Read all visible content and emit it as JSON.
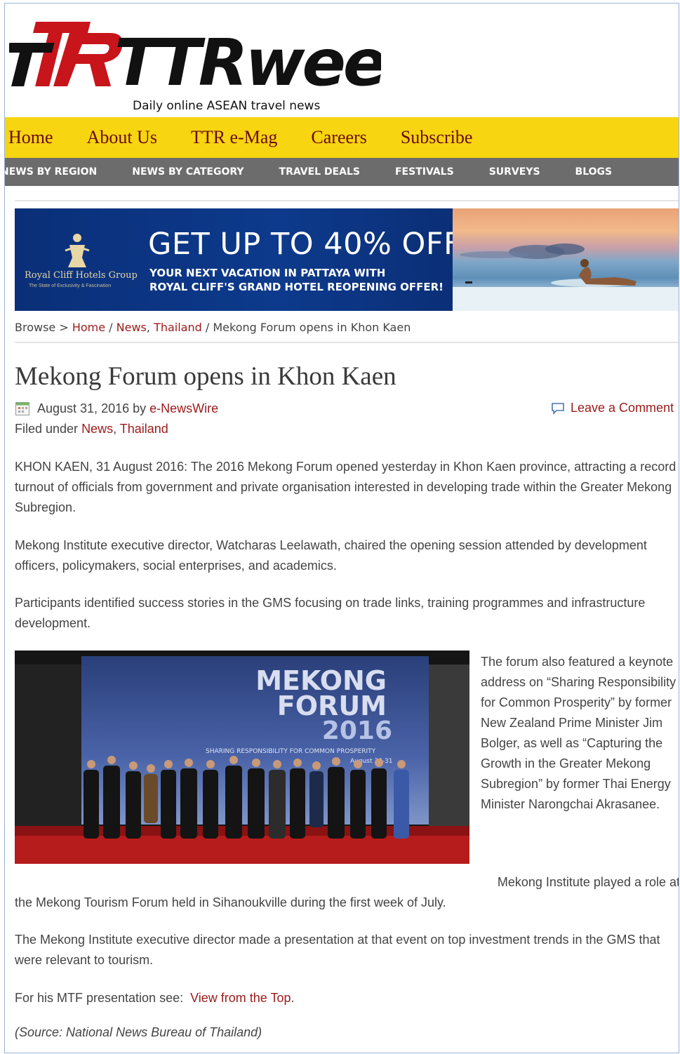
{
  "site": {
    "logo_text": "TTRweekly",
    "tagline": "Daily online ASEAN travel news"
  },
  "topnav": [
    "Home",
    "About Us",
    "TTR e-Mag",
    "Careers",
    "Subscribe"
  ],
  "subnav": [
    "NEWS BY REGION",
    "NEWS BY CATEGORY",
    "TRAVEL DEALS",
    "FESTIVALS",
    "SURVEYS",
    "BLOGS"
  ],
  "banner": {
    "brand": "Royal Cliff Hotels Group",
    "brand_tagline": "The State of Exclusivity & Fascination",
    "headline": "GET UP TO 40% OFF",
    "sub_line1": "YOUR NEXT VACATION IN PATTAYA WITH",
    "sub_line2": "ROYAL CLIFF'S GRAND HOTEL REOPENING OFFER!"
  },
  "breadcrumb": {
    "browse": "Browse >",
    "home": "Home",
    "sep1": " / ",
    "news": "News",
    "comma": ", ",
    "thailand": "Thailand",
    "sep2": " / ",
    "current": "Mekong Forum opens in Khon Kaen"
  },
  "article": {
    "title": "Mekong Forum opens in Khon Kaen",
    "date": "August 31, 2016",
    "by": " by ",
    "author": "e-NewsWire",
    "leave_comment": "Leave a Comment",
    "filed_under": "Filed under ",
    "category1": "News",
    "category_sep": ", ",
    "category2": "Thailand",
    "p1": "KHON KAEN, 31 August 2016: The 2016 Mekong Forum opened yesterday in Khon Kaen province, attracting a record turnout of officials from government and private organisation interested in developing trade within the Greater Mekong Subregion.",
    "p2": "Mekong Institute executive director, Watcharas Leelawath, chaired the opening session attended by development officers, policymakers, social enterprises, and academics.",
    "p3": "Participants identified success stories in the GMS focusing on trade links, training programmes and infrastructure development.",
    "side_text": "The forum also featured a keynote address on “Sharing Responsibility for Common Prosperity” by former New Zealand Prime Minister Jim Bolger, as well as “Capturing the Growth in the Greater Mekong Subregion” by former Thai Energy Minister Narongchai Akrasanee.",
    "p4_line1": "Mekong Institute played a role at",
    "p4_line2": "the Mekong Tourism Forum held in Sihanoukville during the first week of July.",
    "p5": "The Mekong Institute executive director made a presentation at that event on top investment trends in the GMS that were relevant to tourism.",
    "p6_prefix": "For his MTF presentation see:  ",
    "p6_link": "View from the Top",
    "p6_suffix": ".",
    "source": "(Source: National News Bureau of Thailand)"
  },
  "photo": {
    "line1": "MEKONG",
    "line2": "FORUM",
    "line3": "2016",
    "strap": "SHARING RESPONSIBILITY FOR COMMON PROSPERITY",
    "date_strap": "August 30-31"
  },
  "colors": {
    "nav_yellow": "#f7d511",
    "nav_text": "#6a0b0b",
    "subnav_grey": "#6c6c6c",
    "link": "#9b1b1b",
    "logo_red": "#c8141b"
  }
}
